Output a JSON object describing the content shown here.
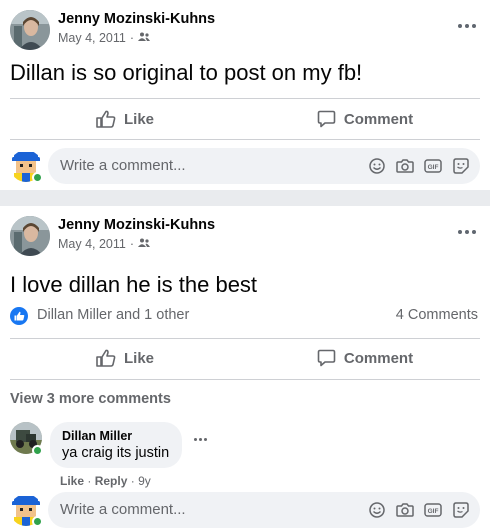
{
  "posts": [
    {
      "author": "Jenny Mozinski-Kuhns",
      "date": "May 4, 2011",
      "date_sep": "·",
      "audience_icon": "friends-icon",
      "text": "Dillan is so original to post on my fb!",
      "actions": {
        "like": "Like",
        "comment": "Comment"
      },
      "composer_placeholder": "Write a comment..."
    },
    {
      "author": "Jenny Mozinski-Kuhns",
      "date": "May 4, 2011",
      "date_sep": "·",
      "audience_icon": "friends-icon",
      "text": "I love dillan he is the best",
      "reactions": {
        "summary": "Dillan Miller and 1 other",
        "comment_count": "4 Comments"
      },
      "actions": {
        "like": "Like",
        "comment": "Comment"
      },
      "view_more": "View 3 more comments",
      "comment": {
        "author": "Dillan Miller",
        "text": "ya craig its justin",
        "like": "Like",
        "sep": "·",
        "reply": "Reply",
        "age": "9y"
      },
      "composer_placeholder": "Write a comment..."
    }
  ],
  "colors": {
    "brand_blue": "#1877f2",
    "online_green": "#31a24c",
    "secondary_text": "#65676b",
    "input_bg": "#f0f2f5"
  },
  "icons": [
    "more-icon",
    "friends-icon",
    "like-icon",
    "comment-icon",
    "emoji-icon",
    "camera-icon",
    "gif-icon",
    "sticker-icon"
  ]
}
